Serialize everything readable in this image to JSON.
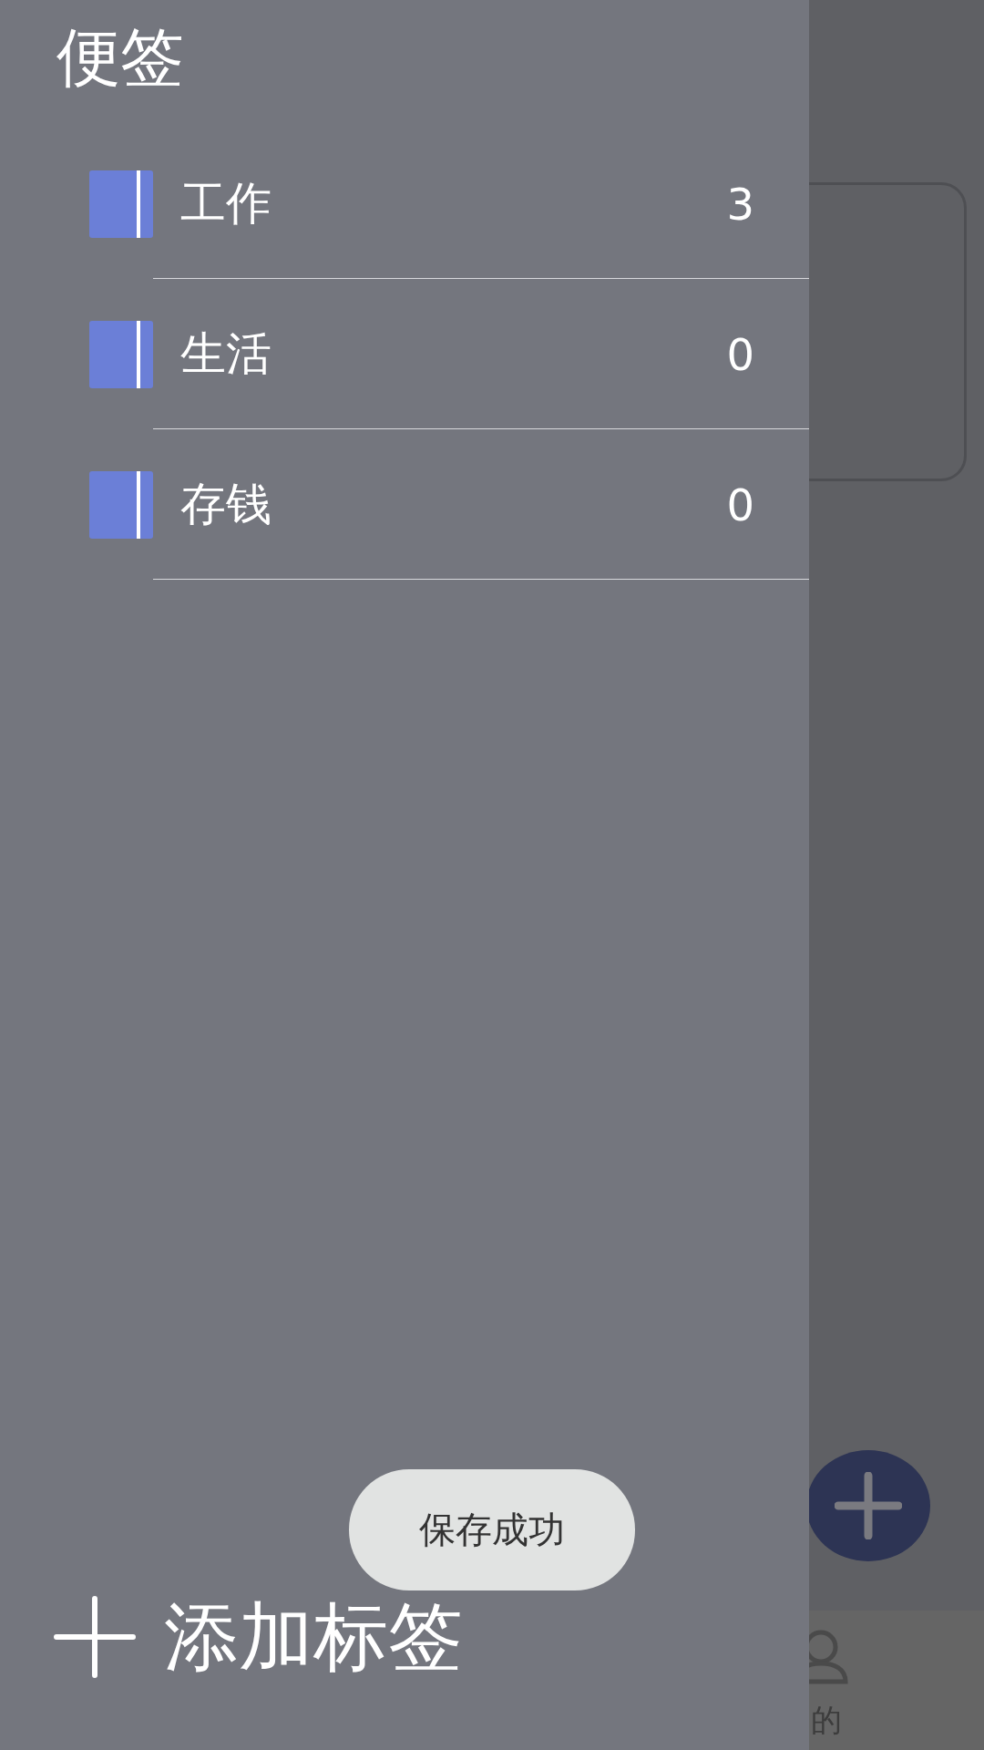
{
  "drawer": {
    "title": "便签",
    "tags": [
      {
        "name": "工作",
        "count": "3"
      },
      {
        "name": "生活",
        "count": "0"
      },
      {
        "name": "存钱",
        "count": "0"
      }
    ],
    "add_button": {
      "label": "添加标签"
    }
  },
  "background": {
    "bottom_nav": {
      "label": "的"
    }
  },
  "toast": {
    "text": "保存成功"
  }
}
